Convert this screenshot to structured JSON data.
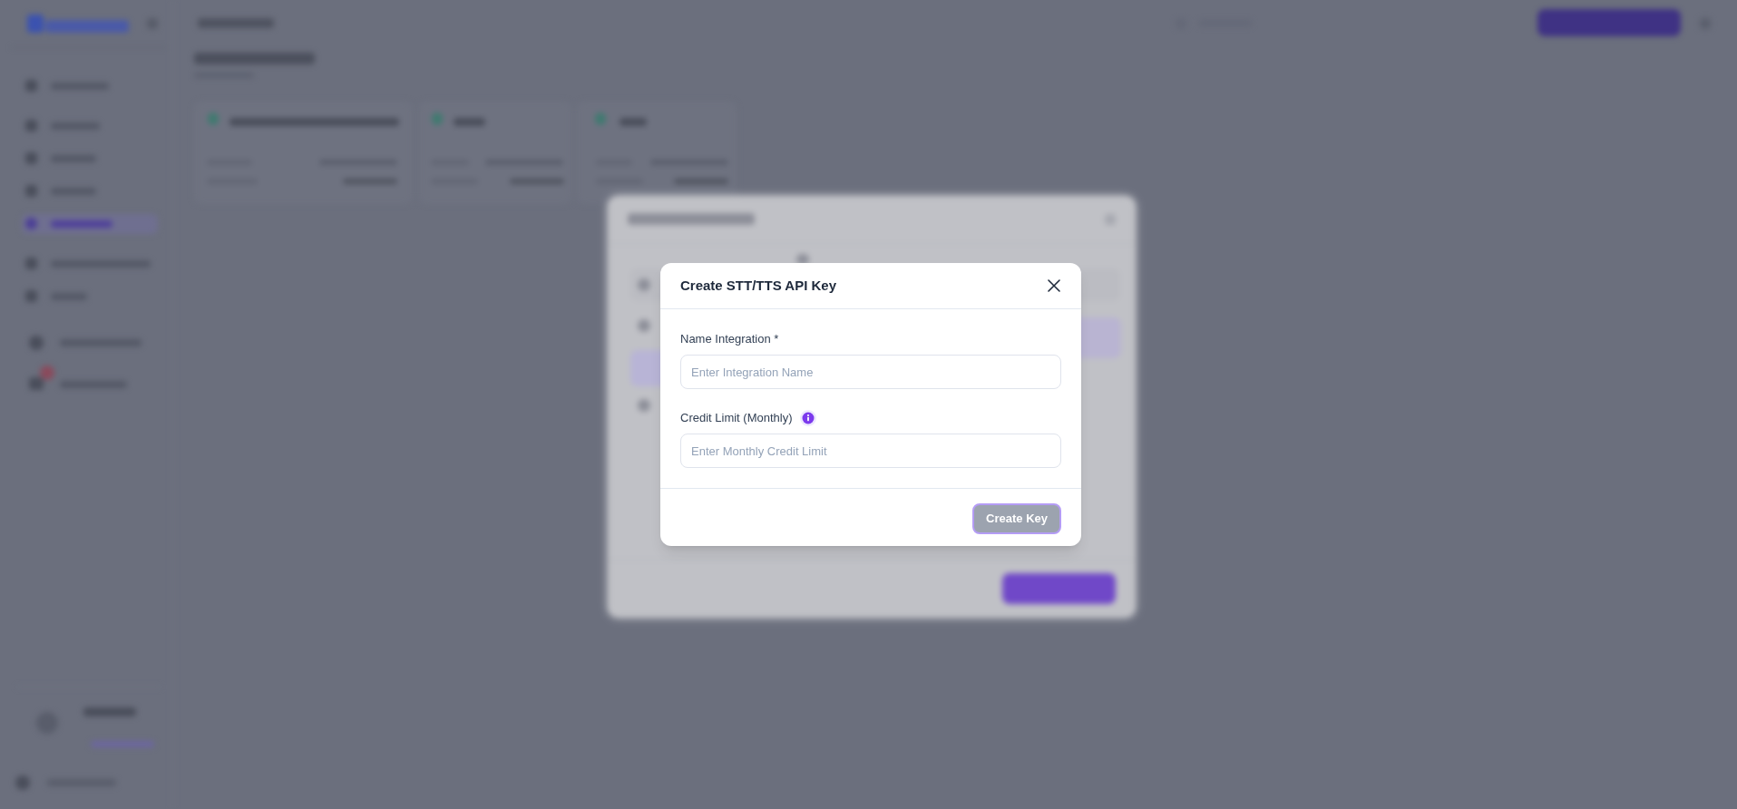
{
  "dialog": {
    "title": "Create STT/TTS API Key",
    "fields": [
      {
        "label": "Name Integration *",
        "placeholder": "Enter Integration Name",
        "info_icon": false
      },
      {
        "label": "Credit Limit (Monthly)",
        "placeholder": "Enter Monthly Credit Limit",
        "info_icon": true
      }
    ],
    "button": {
      "label": "Create Key",
      "disabled": true
    }
  }
}
